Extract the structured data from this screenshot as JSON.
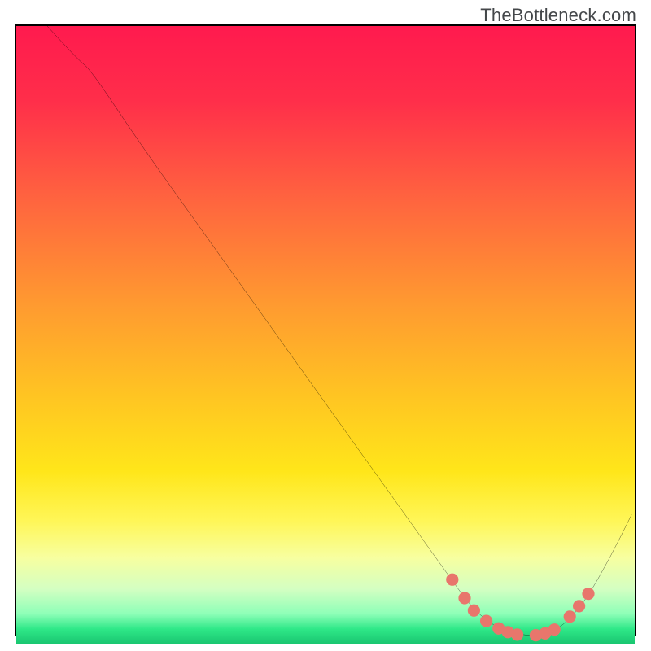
{
  "watermark": "TheBottleneck.com",
  "chart_data": {
    "type": "line",
    "title": "",
    "xlabel": "",
    "ylabel": "",
    "xlim": [
      0,
      100
    ],
    "ylim": [
      0,
      100
    ],
    "series": [
      {
        "name": "curve",
        "x": [
          5,
          10,
          12,
          20,
          30,
          40,
          50,
          60,
          70,
          74,
          78,
          82,
          84,
          88,
          92,
          96,
          99.5
        ],
        "y": [
          100,
          94.5,
          93,
          81,
          67,
          53,
          39,
          25,
          11,
          5.5,
          2.5,
          1.5,
          1.5,
          2.5,
          7,
          14,
          21
        ]
      }
    ],
    "markers": {
      "name": "dots",
      "color": "#e8766c",
      "x": [
        70.5,
        72.5,
        74,
        76,
        78,
        79.5,
        81,
        84,
        85.5,
        87,
        89.5,
        91,
        92.5
      ],
      "y": [
        10.5,
        7.5,
        5.5,
        3.8,
        2.6,
        2.0,
        1.6,
        1.5,
        1.8,
        2.4,
        4.5,
        6.2,
        8.2
      ]
    },
    "background_gradient": {
      "direction": "vertical",
      "stops": [
        {
          "pos": 0.0,
          "color": "#ff1a4e"
        },
        {
          "pos": 0.12,
          "color": "#ff2e4a"
        },
        {
          "pos": 0.28,
          "color": "#ff643f"
        },
        {
          "pos": 0.45,
          "color": "#ff9a30"
        },
        {
          "pos": 0.6,
          "color": "#ffc522"
        },
        {
          "pos": 0.72,
          "color": "#ffe61a"
        },
        {
          "pos": 0.8,
          "color": "#fff657"
        },
        {
          "pos": 0.86,
          "color": "#f7ffa0"
        },
        {
          "pos": 0.91,
          "color": "#d4ffc2"
        },
        {
          "pos": 0.95,
          "color": "#8fffb8"
        },
        {
          "pos": 0.975,
          "color": "#2fe888"
        },
        {
          "pos": 1.0,
          "color": "#18c46f"
        }
      ]
    }
  }
}
